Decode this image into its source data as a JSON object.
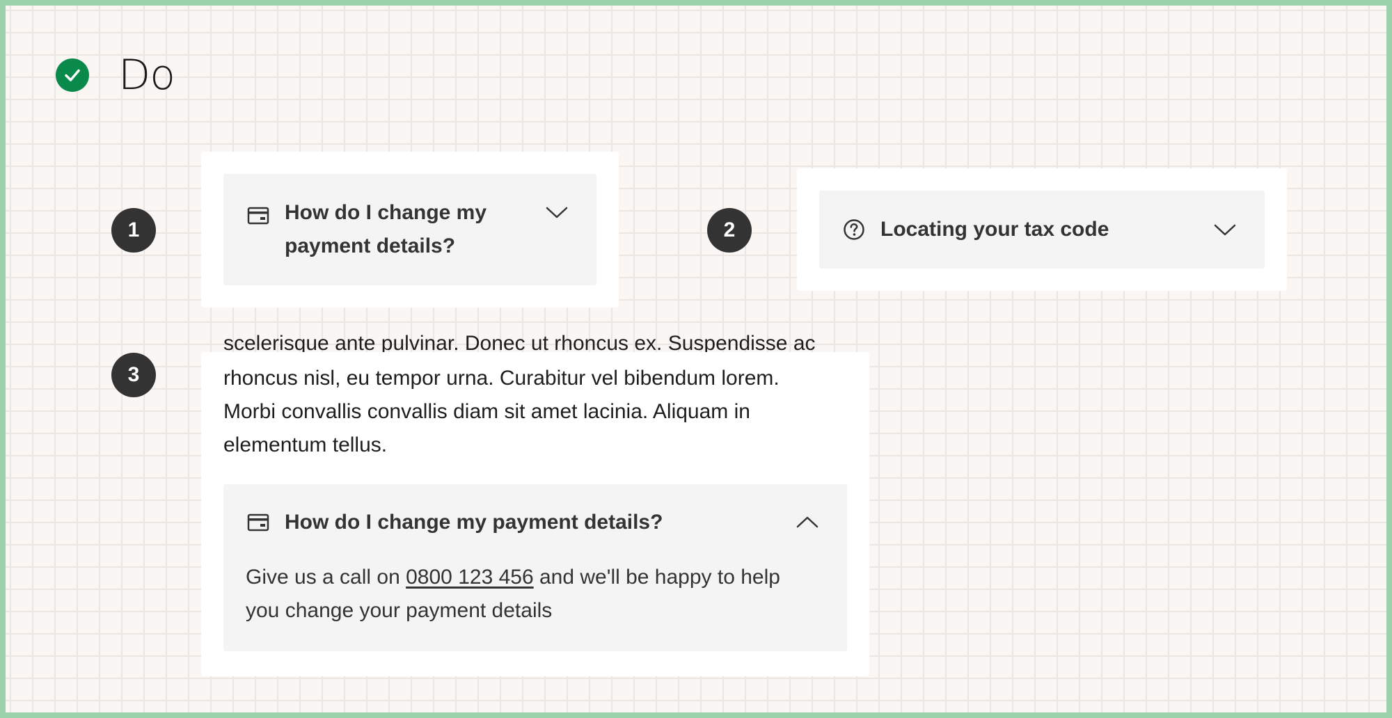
{
  "heading": {
    "label": "Do",
    "icon": "check-circle-icon",
    "icon_color": "#0a8a4a"
  },
  "examples": [
    {
      "number": "1",
      "accordion": {
        "icon": "credit-card-icon",
        "title_line1": "How do I change my",
        "title_line2": "payment details?",
        "chevron": "chevron-down-icon",
        "expanded": false
      }
    },
    {
      "number": "2",
      "accordion": {
        "icon": "question-circle-icon",
        "title": "Locating your tax code",
        "chevron": "chevron-down-icon",
        "expanded": false
      }
    },
    {
      "number": "3",
      "body_text": {
        "clipped_line": "scelerisque ante pulvinar. Donec ut rhoncus ex. Suspendisse ac",
        "line1": "rhoncus nisl, eu tempor urna. Curabitur vel bibendum lorem.",
        "line2": "Morbi convallis convallis diam sit amet lacinia. Aliquam in",
        "line3": "elementum tellus."
      },
      "accordion": {
        "icon": "credit-card-icon",
        "title": "How do I change my payment details?",
        "chevron": "chevron-up-icon",
        "expanded": true,
        "panel": {
          "before_link": "Give us a call on ",
          "link": "0800 123 456",
          "after_link": " and we'll be happy to help",
          "line2": "you change your payment details"
        }
      }
    }
  ],
  "colors": {
    "frame_border": "#9ad1aa",
    "background": "#faf6f3",
    "badge": "#333333",
    "accordion_bg": "#f4f4f4"
  }
}
